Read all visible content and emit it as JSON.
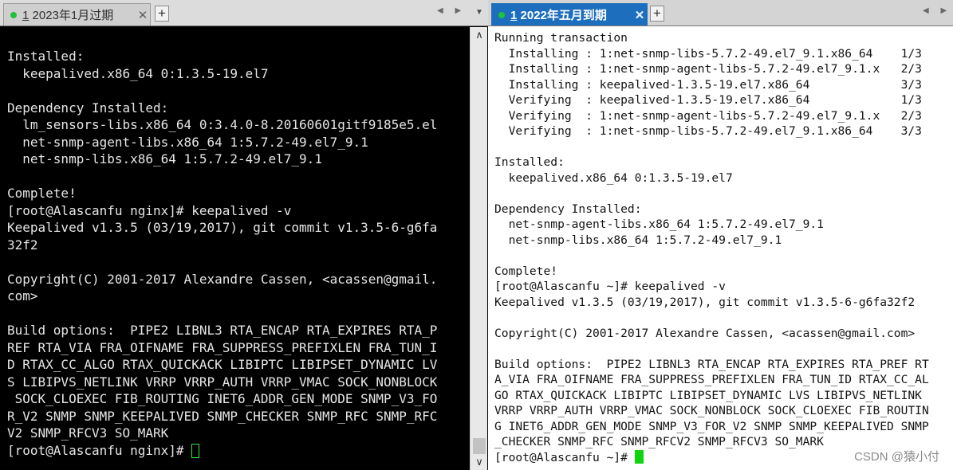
{
  "left": {
    "tab": {
      "number": "1",
      "title": " 2023年1月过期",
      "close": "✕",
      "status_color": "#1fc338"
    },
    "new_tab_label": "+",
    "nav_arrows": "◀ ▶",
    "menu_arrow": "▼",
    "lines": [
      "Installed:",
      "  keepalived.x86_64 0:1.3.5-19.el7",
      "",
      "Dependency Installed:",
      "  lm_sensors-libs.x86_64 0:3.4.0-8.20160601gitf9185e5.el",
      "  net-snmp-agent-libs.x86_64 1:5.7.2-49.el7_9.1",
      "  net-snmp-libs.x86_64 1:5.7.2-49.el7_9.1",
      "",
      "Complete!",
      "[root@Alascanfu nginx]# keepalived -v",
      "Keepalived v1.3.5 (03/19,2017), git commit v1.3.5-6-g6fa",
      "32f2",
      "",
      "Copyright(C) 2001-2017 Alexandre Cassen, <acassen@gmail.",
      "com>",
      "",
      "Build options:  PIPE2 LIBNL3 RTA_ENCAP RTA_EXPIRES RTA_P",
      "REF RTA_VIA FRA_OIFNAME FRA_SUPPRESS_PREFIXLEN FRA_TUN_I",
      "D RTAX_CC_ALGO RTAX_QUICKACK LIBIPTC LIBIPSET_DYNAMIC LV",
      "S LIBIPVS_NETLINK VRRP VRRP_AUTH VRRP_VMAC SOCK_NONBLOCK",
      " SOCK_CLOEXEC FIB_ROUTING INET6_ADDR_GEN_MODE SNMP_V3_FO",
      "R_V2 SNMP SNMP_KEEPALIVED SNMP_CHECKER SNMP_RFC SNMP_RFC",
      "V2 SNMP_RFCV3 SO_MARK"
    ],
    "prompt": "[root@Alascanfu nginx]# ",
    "scroll_up": "∧",
    "scroll_down": "∨"
  },
  "right": {
    "tab": {
      "number": "1",
      "title": " 2022年五月到期",
      "close": "✕",
      "status_color": "#1fc338"
    },
    "new_tab_label": "+",
    "nav_arrows": "◀ ▶",
    "lines": [
      "Running transaction",
      "  Installing : 1:net-snmp-libs-5.7.2-49.el7_9.1.x86_64    1/3",
      "  Installing : 1:net-snmp-agent-libs-5.7.2-49.el7_9.1.x   2/3",
      "  Installing : keepalived-1.3.5-19.el7.x86_64             3/3",
      "  Verifying  : keepalived-1.3.5-19.el7.x86_64             1/3",
      "  Verifying  : 1:net-snmp-agent-libs-5.7.2-49.el7_9.1.x   2/3",
      "  Verifying  : 1:net-snmp-libs-5.7.2-49.el7_9.1.x86_64    3/3",
      "",
      "Installed:",
      "  keepalived.x86_64 0:1.3.5-19.el7",
      "",
      "Dependency Installed:",
      "  net-snmp-agent-libs.x86_64 1:5.7.2-49.el7_9.1",
      "  net-snmp-libs.x86_64 1:5.7.2-49.el7_9.1",
      "",
      "Complete!",
      "[root@Alascanfu ~]# keepalived -v",
      "Keepalived v1.3.5 (03/19,2017), git commit v1.3.5-6-g6fa32f2",
      "",
      "Copyright(C) 2001-2017 Alexandre Cassen, <acassen@gmail.com>",
      "",
      "Build options:  PIPE2 LIBNL3 RTA_ENCAP RTA_EXPIRES RTA_PREF RT",
      "A_VIA FRA_OIFNAME FRA_SUPPRESS_PREFIXLEN FRA_TUN_ID RTAX_CC_AL",
      "GO RTAX_QUICKACK LIBIPTC LIBIPSET_DYNAMIC LVS LIBIPVS_NETLINK",
      "VRRP VRRP_AUTH VRRP_VMAC SOCK_NONBLOCK SOCK_CLOEXEC FIB_ROUTIN",
      "G INET6_ADDR_GEN_MODE SNMP_V3_FOR_V2 SNMP SNMP_KEEPALIVED SNMP",
      "_CHECKER SNMP_RFC SNMP_RFCV2 SNMP_RFCV3 SO_MARK"
    ],
    "prompt": "[root@Alascanfu ~]# "
  },
  "watermark": "CSDN @猿小付",
  "colors": {
    "tab_active": "#1d6fbe",
    "cursor": "#11d411",
    "left_bg": "#000000",
    "right_bg": "#ffffff"
  }
}
